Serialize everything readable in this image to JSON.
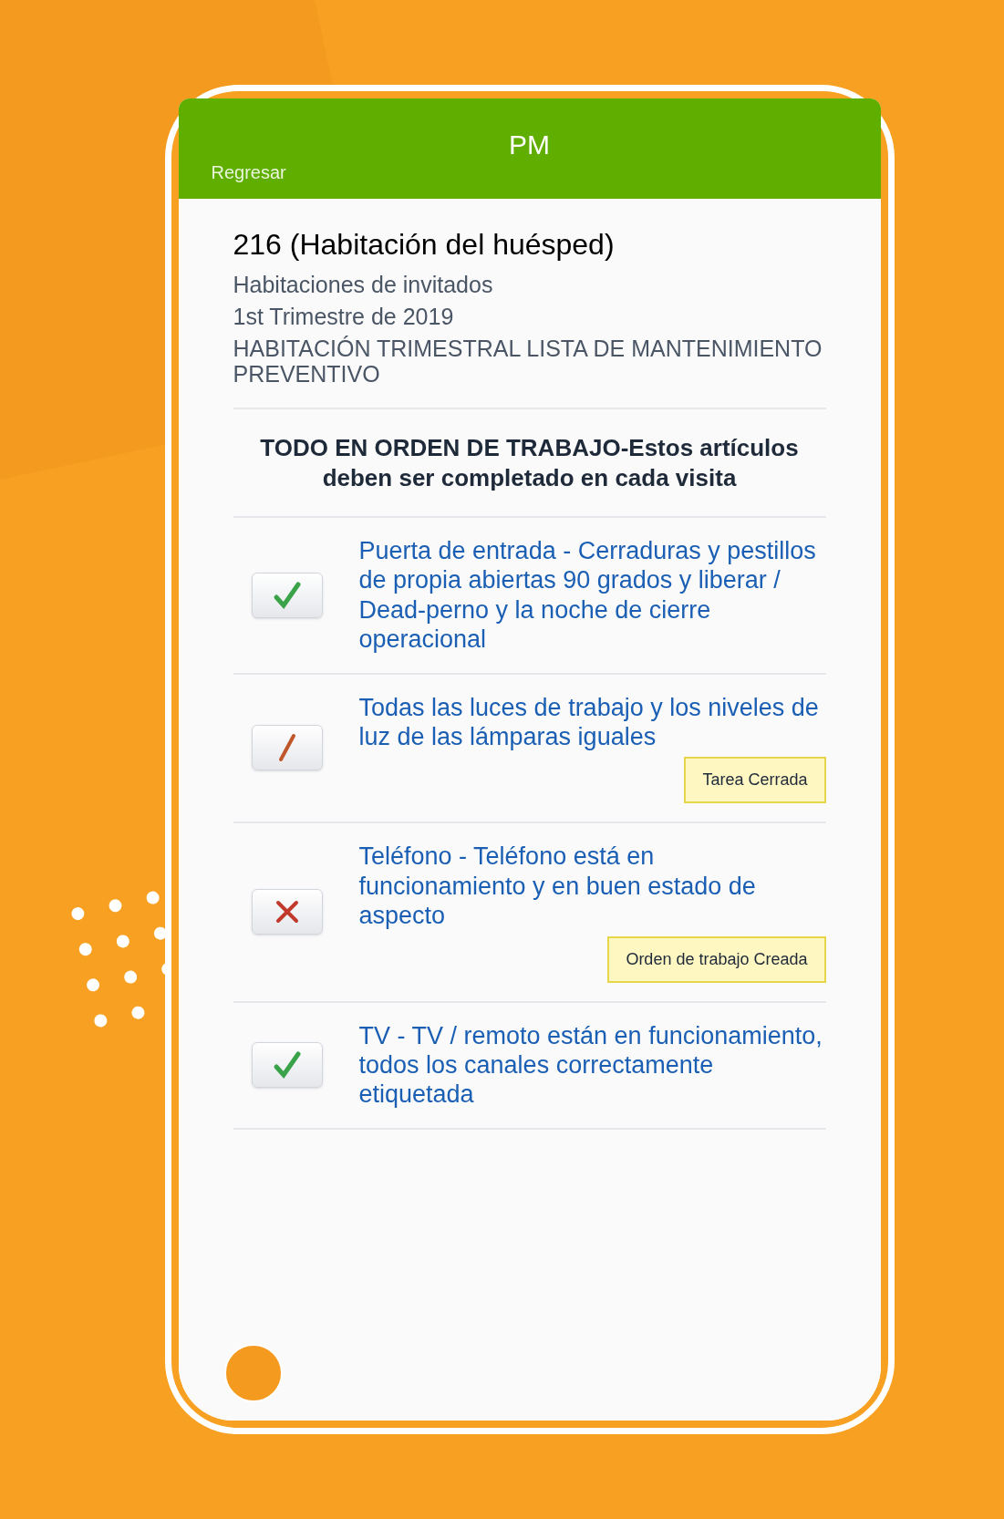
{
  "header": {
    "title": "PM",
    "back": "Regresar"
  },
  "room": {
    "title": "216 (Habitación del huésped)",
    "lines": [
      "Habitaciones de invitados",
      "1st Trimestre de 2019",
      "HABITACIÓN TRIMESTRAL LISTA DE MANTENIMIENTO PREVENTIVO"
    ]
  },
  "section": {
    "title": "TODO EN ORDEN DE TRABAJO-Estos artículos deben ser completado en cada visita"
  },
  "items": [
    {
      "kind": "check",
      "label": "Puerta de entrada - Cerraduras y pestillos de propia abiertas 90 grados y liberar / Dead-perno y la noche de cierre operacional"
    },
    {
      "kind": "slash",
      "label": "Todas las luces de trabajo y los niveles de luz de las lámparas iguales",
      "badge": "Tarea Cerrada"
    },
    {
      "kind": "cross",
      "label": "Teléfono - Teléfono está en funcionamiento y en buen estado de aspecto",
      "badge": "Orden de trabajo Creada"
    },
    {
      "kind": "check",
      "label": "TV - TV / remoto están en funcionamiento, todos los canales correctamente etiquetada"
    }
  ]
}
